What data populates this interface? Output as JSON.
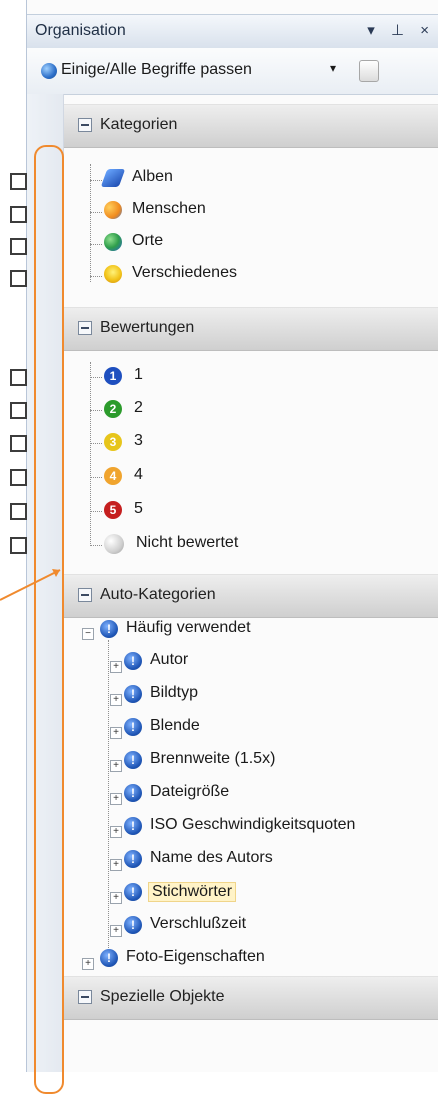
{
  "panel": {
    "title": "Organisation",
    "title_icons": "▾ ⊥ ×",
    "toolbar_match_label": "Einige/Alle Begriffe passen",
    "toolbar_dropdown_glyph": "▾"
  },
  "sections": {
    "kategorien": {
      "title": "Kategorien",
      "items": [
        "Alben",
        "Menschen",
        "Orte",
        "Verschiedenes"
      ]
    },
    "bewertungen": {
      "title": "Bewertungen",
      "items": [
        "1",
        "2",
        "3",
        "4",
        "5",
        "Nicht bewertet"
      ],
      "badges": [
        "1",
        "2",
        "3",
        "4",
        "5"
      ]
    },
    "auto_kategorien": {
      "title": "Auto-Kategorien",
      "root": "Häufig verwendet",
      "children": [
        "Autor",
        "Bildtyp",
        "Blende",
        "Brennweite (1.5x)",
        "Dateigröße",
        "ISO Geschwindigkeitsquoten",
        "Name des Autors",
        "Stichwörter",
        "Verschlußzeit"
      ],
      "second_root": "Foto-Eigenschaften"
    },
    "spezielle": {
      "title": "Spezielle Objekte"
    }
  },
  "colors": {
    "accent_bracket": "#f08a2e",
    "rating_colors": [
      "#1e4fbf",
      "#2c9b2c",
      "#e7c51b",
      "#f0a42e",
      "#c51f1f",
      "#d6d6d6"
    ]
  }
}
